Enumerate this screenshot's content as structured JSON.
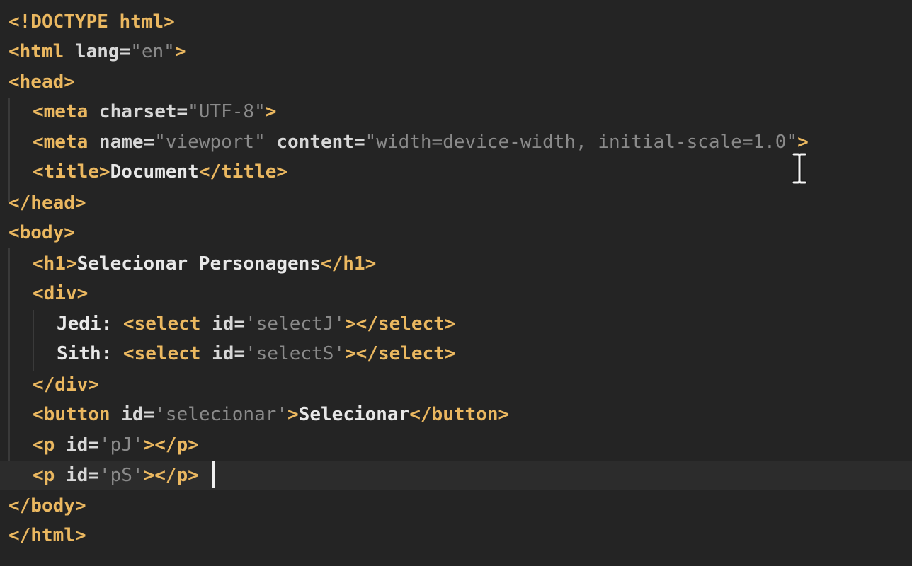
{
  "editor": {
    "lines": [
      {
        "segments": [
          {
            "t": "<!DOCTYPE html>",
            "c": "tag"
          }
        ]
      },
      {
        "segments": [
          {
            "t": "<html ",
            "c": "tag"
          },
          {
            "t": "lang=",
            "c": "attr"
          },
          {
            "t": "\"en\"",
            "c": "str"
          },
          {
            "t": ">",
            "c": "tag"
          }
        ]
      },
      {
        "segments": [
          {
            "t": "<head>",
            "c": "tag"
          }
        ]
      },
      {
        "segments": [
          {
            "t": "<meta ",
            "c": "tag"
          },
          {
            "t": "charset=",
            "c": "attr"
          },
          {
            "t": "\"UTF-8\"",
            "c": "str"
          },
          {
            "t": ">",
            "c": "tag"
          }
        ]
      },
      {
        "segments": [
          {
            "t": "<meta ",
            "c": "tag"
          },
          {
            "t": "name=",
            "c": "attr"
          },
          {
            "t": "\"viewport\" ",
            "c": "str"
          },
          {
            "t": "content=",
            "c": "attr"
          },
          {
            "t": "\"width=device-width, initial-scale=1.0\"",
            "c": "str"
          },
          {
            "t": ">",
            "c": "tag"
          }
        ]
      },
      {
        "segments": [
          {
            "t": "<title>",
            "c": "tag"
          },
          {
            "t": "Document",
            "c": "txt"
          },
          {
            "t": "</title>",
            "c": "tag"
          }
        ]
      },
      {
        "segments": [
          {
            "t": "</head>",
            "c": "tag"
          }
        ]
      },
      {
        "segments": [
          {
            "t": "<body>",
            "c": "tag"
          }
        ]
      },
      {
        "segments": [
          {
            "t": "<h1>",
            "c": "tag"
          },
          {
            "t": "Selecionar Personagens",
            "c": "txt"
          },
          {
            "t": "</h1>",
            "c": "tag"
          }
        ]
      },
      {
        "segments": [
          {
            "t": "<div>",
            "c": "tag"
          }
        ]
      },
      {
        "segments": [
          {
            "t": "Jedi: ",
            "c": "txt"
          },
          {
            "t": "<select ",
            "c": "tag"
          },
          {
            "t": "id=",
            "c": "attr"
          },
          {
            "t": "'selectJ'",
            "c": "str"
          },
          {
            "t": "></select>",
            "c": "tag"
          }
        ]
      },
      {
        "segments": [
          {
            "t": "Sith: ",
            "c": "txt"
          },
          {
            "t": "<select ",
            "c": "tag"
          },
          {
            "t": "id=",
            "c": "attr"
          },
          {
            "t": "'selectS'",
            "c": "str"
          },
          {
            "t": "></select>",
            "c": "tag"
          }
        ]
      },
      {
        "segments": [
          {
            "t": "</div>",
            "c": "tag"
          }
        ]
      },
      {
        "segments": [
          {
            "t": "<button ",
            "c": "tag"
          },
          {
            "t": "id=",
            "c": "attr"
          },
          {
            "t": "'selecionar'",
            "c": "str"
          },
          {
            "t": ">",
            "c": "tag"
          },
          {
            "t": "Selecionar",
            "c": "txt"
          },
          {
            "t": "</button>",
            "c": "tag"
          }
        ]
      },
      {
        "segments": [
          {
            "t": "<p ",
            "c": "tag"
          },
          {
            "t": "id=",
            "c": "attr"
          },
          {
            "t": "'pJ'",
            "c": "str"
          },
          {
            "t": "></p>",
            "c": "tag"
          }
        ]
      },
      {
        "segments": [
          {
            "t": "<p ",
            "c": "tag"
          },
          {
            "t": "id=",
            "c": "attr"
          },
          {
            "t": "'pS'",
            "c": "str"
          },
          {
            "t": "></p>",
            "c": "tag"
          }
        ]
      },
      {
        "segments": [
          {
            "t": "</body>",
            "c": "tag"
          }
        ]
      },
      {
        "segments": [
          {
            "t": "</html>",
            "c": "tag"
          }
        ]
      }
    ],
    "colors": {
      "background": "#242424",
      "current_line": "#2c2c2c",
      "tag": "#ebb860",
      "string": "#8a8a8a",
      "text": "#e8e8e8"
    },
    "cursor_icon": "text-cursor-icon"
  }
}
